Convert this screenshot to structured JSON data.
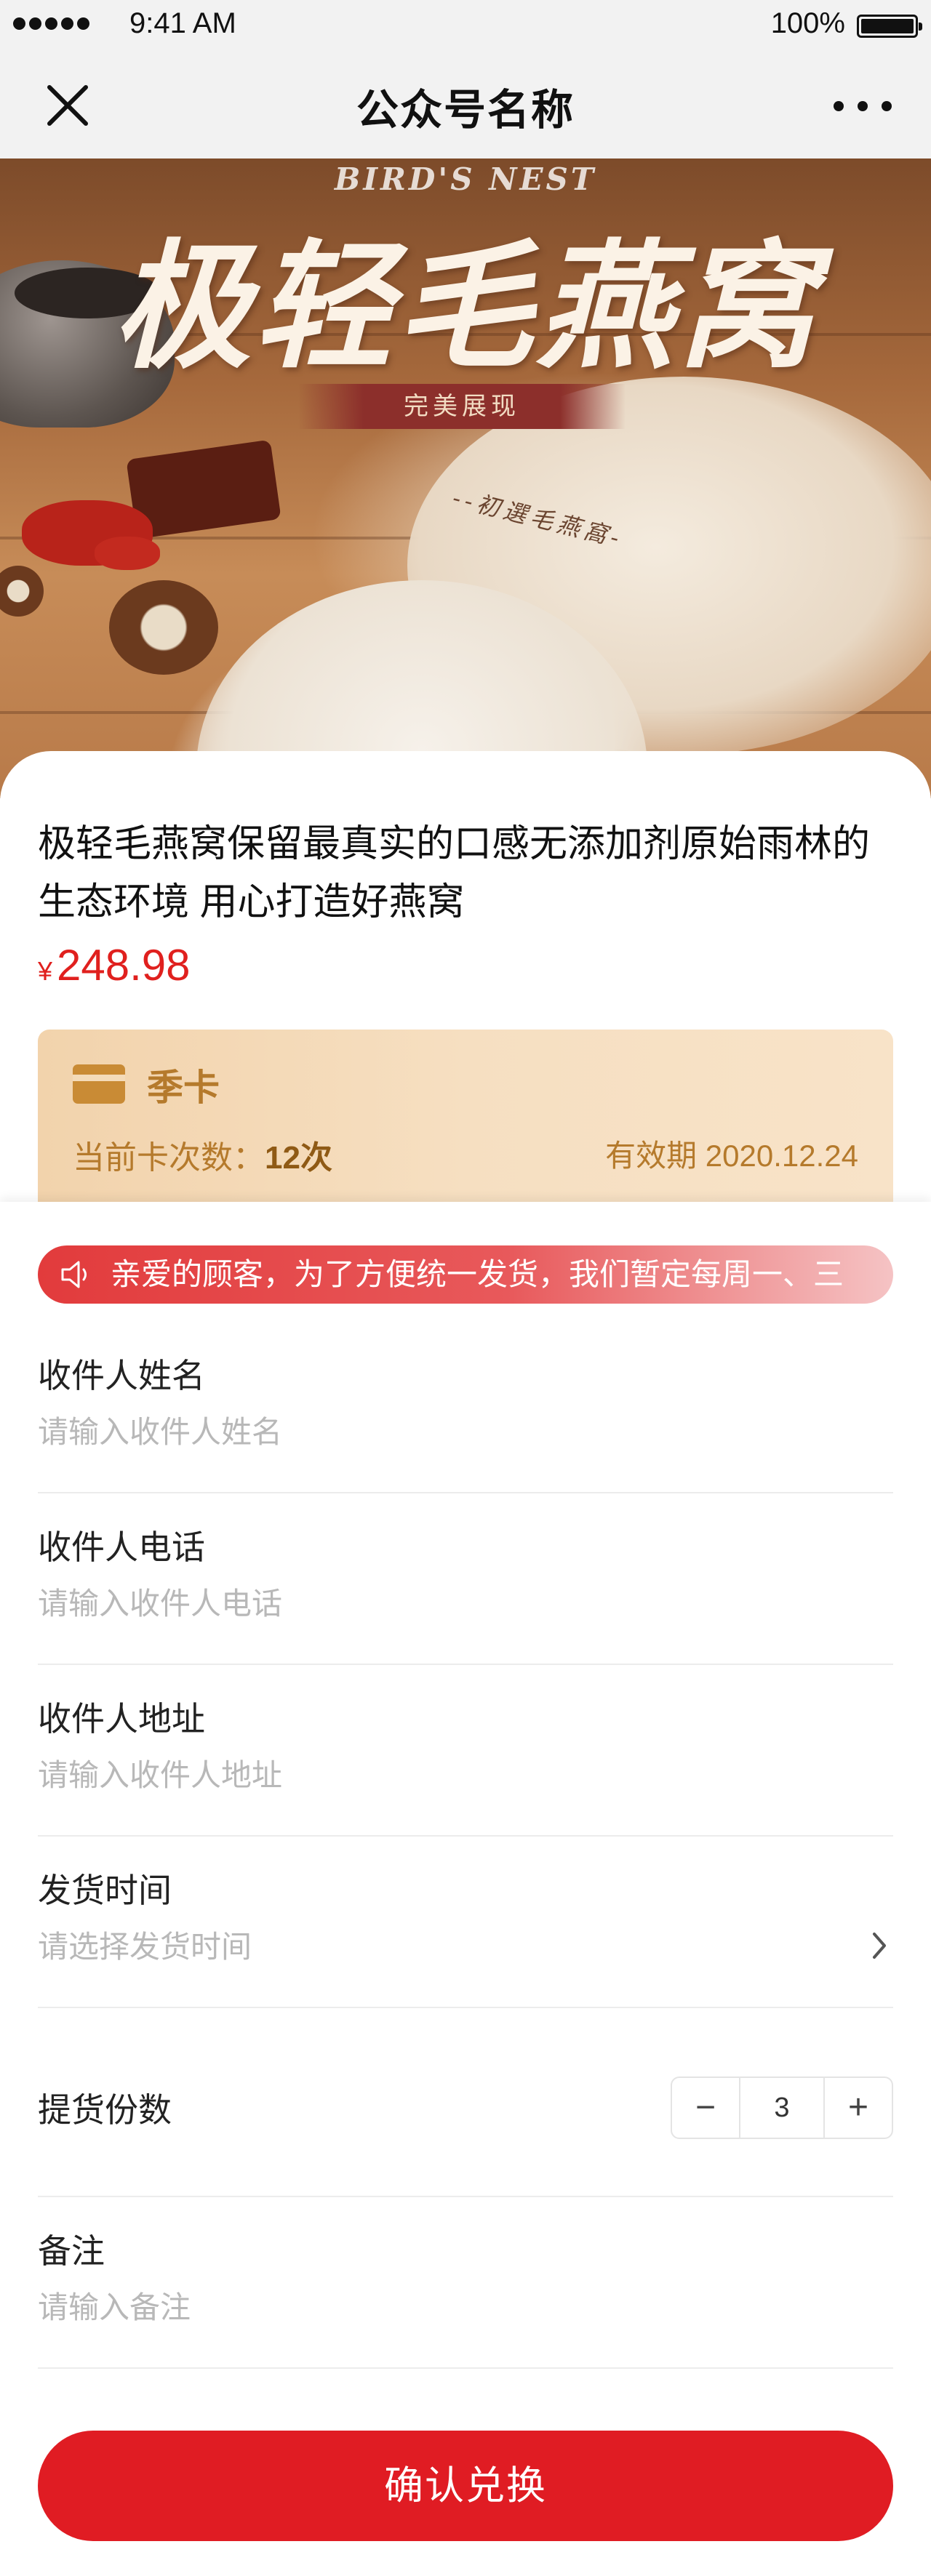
{
  "status_bar": {
    "time": "9:41 AM",
    "battery": "100%"
  },
  "nav": {
    "title": "公众号名称",
    "close_icon": "close-icon",
    "more_icon": "more-icon"
  },
  "hero": {
    "english_title": "BIRD'S NEST",
    "title": "极轻毛燕窝",
    "ribbon": "完美展现",
    "subtitle": "--初選毛燕窩-"
  },
  "product": {
    "title": "极轻毛燕窝保留最真实的口感无添加剂原始雨林的生态环境 用心打造好燕窝",
    "currency": "¥",
    "price": "248.98"
  },
  "card": {
    "name": "季卡",
    "count_label": "当前卡次数：",
    "count_value": "12次",
    "expiry": "有效期 2020.12.24"
  },
  "notice": {
    "text": "亲爱的顾客，为了方便统一发货，我们暂定每周一、三"
  },
  "form": {
    "fields": [
      {
        "label": "收件人姓名",
        "placeholder": "请输入收件人姓名"
      },
      {
        "label": "收件人电话",
        "placeholder": "请输入收件人电话"
      },
      {
        "label": "收件人地址",
        "placeholder": "请输入收件人地址"
      },
      {
        "label": "发货时间",
        "placeholder": "请选择发货时间"
      }
    ],
    "quantity": {
      "label": "提货份数",
      "minus": "−",
      "value": "3",
      "plus": "+"
    },
    "remark": {
      "label": "备注",
      "placeholder": "请输入备注"
    },
    "submit_label": "确认兑换"
  },
  "colors": {
    "accent": "#e01c23",
    "price": "#e0201e",
    "card_text": "#b57a2c",
    "card_bg": "#f6dfc1"
  }
}
